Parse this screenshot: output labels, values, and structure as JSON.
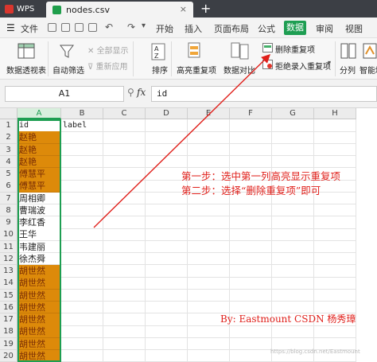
{
  "titlebar": {
    "app_tab": "WPS",
    "file_tab": "nodes.csv",
    "close_glyph": "×",
    "new_tab_glyph": "+"
  },
  "menubar": {
    "file_label": "文件",
    "items": [
      "开始",
      "插入",
      "页面布局",
      "公式",
      "数据",
      "审阅",
      "视图"
    ],
    "active": "数据"
  },
  "ribbon": {
    "pivot_label": "数据透视表",
    "autofilter_label": "自动筛选",
    "show_all_label": "全部显示",
    "reapply_label": "重新应用",
    "sort_label": "排序",
    "highlight_dup_label": "高亮重复项",
    "compare_label": "数据对比",
    "delete_dup_label": "删除重复项",
    "reject_dup_label": "拒绝录入重复项",
    "split_label": "分列",
    "smart_fill_label": "智能填"
  },
  "formula_bar": {
    "name_box": "A1",
    "fx_glyph": "fx",
    "formula": "id"
  },
  "columns": [
    "A",
    "B",
    "C",
    "D",
    "E",
    "F",
    "G",
    "H"
  ],
  "selected_column": "A",
  "rows": [
    {
      "n": "1",
      "a": "id",
      "b": "label",
      "dup": false
    },
    {
      "n": "2",
      "a": "赵艳",
      "b": "",
      "dup": true
    },
    {
      "n": "3",
      "a": "赵艳",
      "b": "",
      "dup": true
    },
    {
      "n": "4",
      "a": "赵艳",
      "b": "",
      "dup": true
    },
    {
      "n": "5",
      "a": "傅慧平",
      "b": "",
      "dup": true
    },
    {
      "n": "6",
      "a": "傅慧平",
      "b": "",
      "dup": true
    },
    {
      "n": "7",
      "a": "周相卿",
      "b": "",
      "dup": false
    },
    {
      "n": "8",
      "a": "曹瑞波",
      "b": "",
      "dup": false
    },
    {
      "n": "9",
      "a": "李红香",
      "b": "",
      "dup": false
    },
    {
      "n": "10",
      "a": "王华",
      "b": "",
      "dup": false
    },
    {
      "n": "11",
      "a": "韦建丽",
      "b": "",
      "dup": false
    },
    {
      "n": "12",
      "a": "徐杰舜",
      "b": "",
      "dup": false
    },
    {
      "n": "13",
      "a": "胡世然",
      "b": "",
      "dup": true
    },
    {
      "n": "14",
      "a": "胡世然",
      "b": "",
      "dup": true
    },
    {
      "n": "15",
      "a": "胡世然",
      "b": "",
      "dup": true
    },
    {
      "n": "16",
      "a": "胡世然",
      "b": "",
      "dup": true
    },
    {
      "n": "17",
      "a": "胡世然",
      "b": "",
      "dup": true
    },
    {
      "n": "18",
      "a": "胡世然",
      "b": "",
      "dup": true
    },
    {
      "n": "19",
      "a": "胡世然",
      "b": "",
      "dup": true
    },
    {
      "n": "20",
      "a": "胡世然",
      "b": "",
      "dup": true
    }
  ],
  "annotations": {
    "step1": "第一步：选中第一列高亮显示重复项",
    "step2": "第二步：选择“删除重复项”即可",
    "byline": "By: Eastmount CSDN 杨秀璋",
    "watermark": "https://blog.csdn.net/Eastmount",
    "color": "#e0201b"
  },
  "colors": {
    "duplicate_fill": "#dd8a0a",
    "accent": "#1e9e52",
    "titlebar": "#3c3f45"
  }
}
